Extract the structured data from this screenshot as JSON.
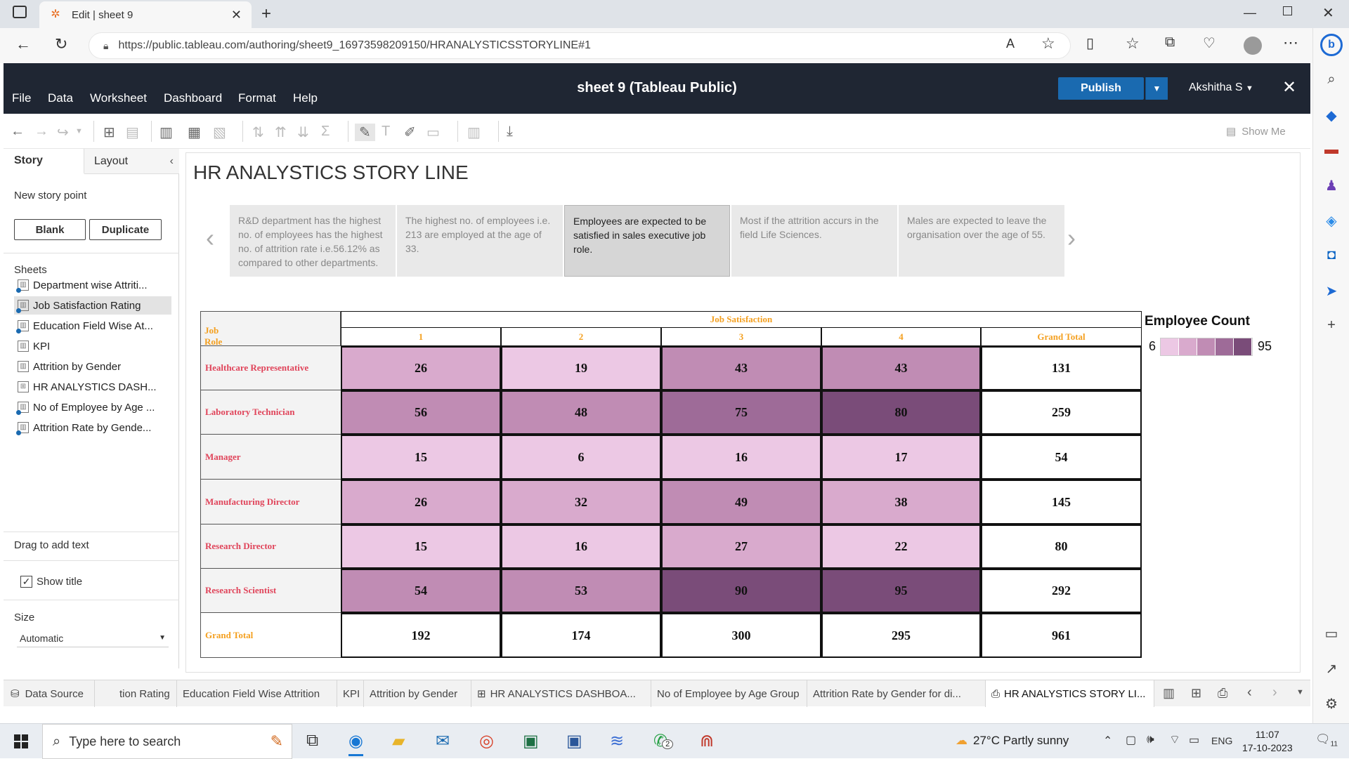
{
  "browser": {
    "tab_title": "Edit | sheet 9",
    "url": "https://public.tableau.com/authoring/sheet9_16973598209150/HRANALYSTICSSTORYLINE#1"
  },
  "app": {
    "title": "sheet 9 (Tableau Public)",
    "menus": [
      "File",
      "Data",
      "Worksheet",
      "Dashboard",
      "Format",
      "Help"
    ],
    "publish_label": "Publish",
    "user": "Akshitha S",
    "show_me": "Show Me"
  },
  "left_panel": {
    "tabs": [
      "Story",
      "Layout"
    ],
    "new_story_point": "New story point",
    "blank_button": "Blank",
    "duplicate_button": "Duplicate",
    "sheets_heading": "Sheets",
    "sheets": [
      "Department wise Attriti...",
      "Job Satisfaction Rating",
      "Education Field Wise At...",
      "KPI",
      "Attrition by Gender",
      "HR ANALYSTICS DASH...",
      "No of Employee by Age ...",
      "Attrition Rate by Gende..."
    ],
    "selected_sheet": "Job Satisfaction Rating",
    "drag_text": "Drag to add text",
    "show_title_label": "Show title",
    "show_title_checked": true,
    "size_heading": "Size",
    "size_value": "Automatic"
  },
  "story": {
    "title": "HR ANALYSTICS STORY LINE",
    "points": [
      "R&D department has the highest no. of employees has the highest no. of attrition rate i.e.56.12% as compared to other departments.",
      "The highest no. of employees i.e. 213 are employed at the age of 33.",
      "Employees are expected to be satisfied in sales executive job role.",
      "Most if the attrition accurs in the field Life Sciences.",
      "Males are expected to leave the organisation over the age of 55."
    ],
    "active_point": 2
  },
  "crosstab": {
    "row_header": "Job Role",
    "column_header": "Job Satisfaction",
    "columns": [
      "1",
      "2",
      "3",
      "4",
      "Grand Total"
    ],
    "rows": [
      {
        "role": "Healthcare Representative",
        "values": [
          26,
          19,
          43,
          43
        ],
        "total": 131
      },
      {
        "role": "Laboratory Technician",
        "values": [
          56,
          48,
          75,
          80
        ],
        "total": 259
      },
      {
        "role": "Manager",
        "values": [
          15,
          6,
          16,
          17
        ],
        "total": 54
      },
      {
        "role": "Manufacturing Director",
        "values": [
          26,
          32,
          49,
          38
        ],
        "total": 145
      },
      {
        "role": "Research Director",
        "values": [
          15,
          16,
          27,
          22
        ],
        "total": 80
      },
      {
        "role": "Research Scientist",
        "values": [
          54,
          53,
          90,
          95
        ],
        "total": 292
      }
    ],
    "grand_total_label": "Grand Total",
    "grand_totals": [
      192,
      174,
      300,
      295,
      961
    ]
  },
  "legend": {
    "title": "Employee Count",
    "min": "6",
    "max": "95",
    "colors": [
      "#ecc8e4",
      "#d9aacd",
      "#c08cb4",
      "#9e6b98",
      "#7a4c79"
    ]
  },
  "sheet_tabs": [
    "Data Source",
    "tion Rating",
    "Education Field Wise Attrition",
    "KPI",
    "Attrition by Gender",
    "HR ANALYSTICS DASHBOA...",
    "No of Employee by Age Group",
    "Attrition Rate by Gender for di...",
    "HR ANALYSTICS STORY LI..."
  ],
  "taskbar": {
    "search_placeholder": "Type here to search",
    "weather": "27°C  Partly sunny",
    "language": "ENG",
    "time": "11:07",
    "date": "17-10-2023",
    "notification_count": "11",
    "whatsapp_badge": "2"
  },
  "colors": {
    "brand_dark": "#1f2633",
    "publish_blue": "#1a6ab0",
    "role_text": "#e0445a",
    "header_text": "#f4a020"
  }
}
